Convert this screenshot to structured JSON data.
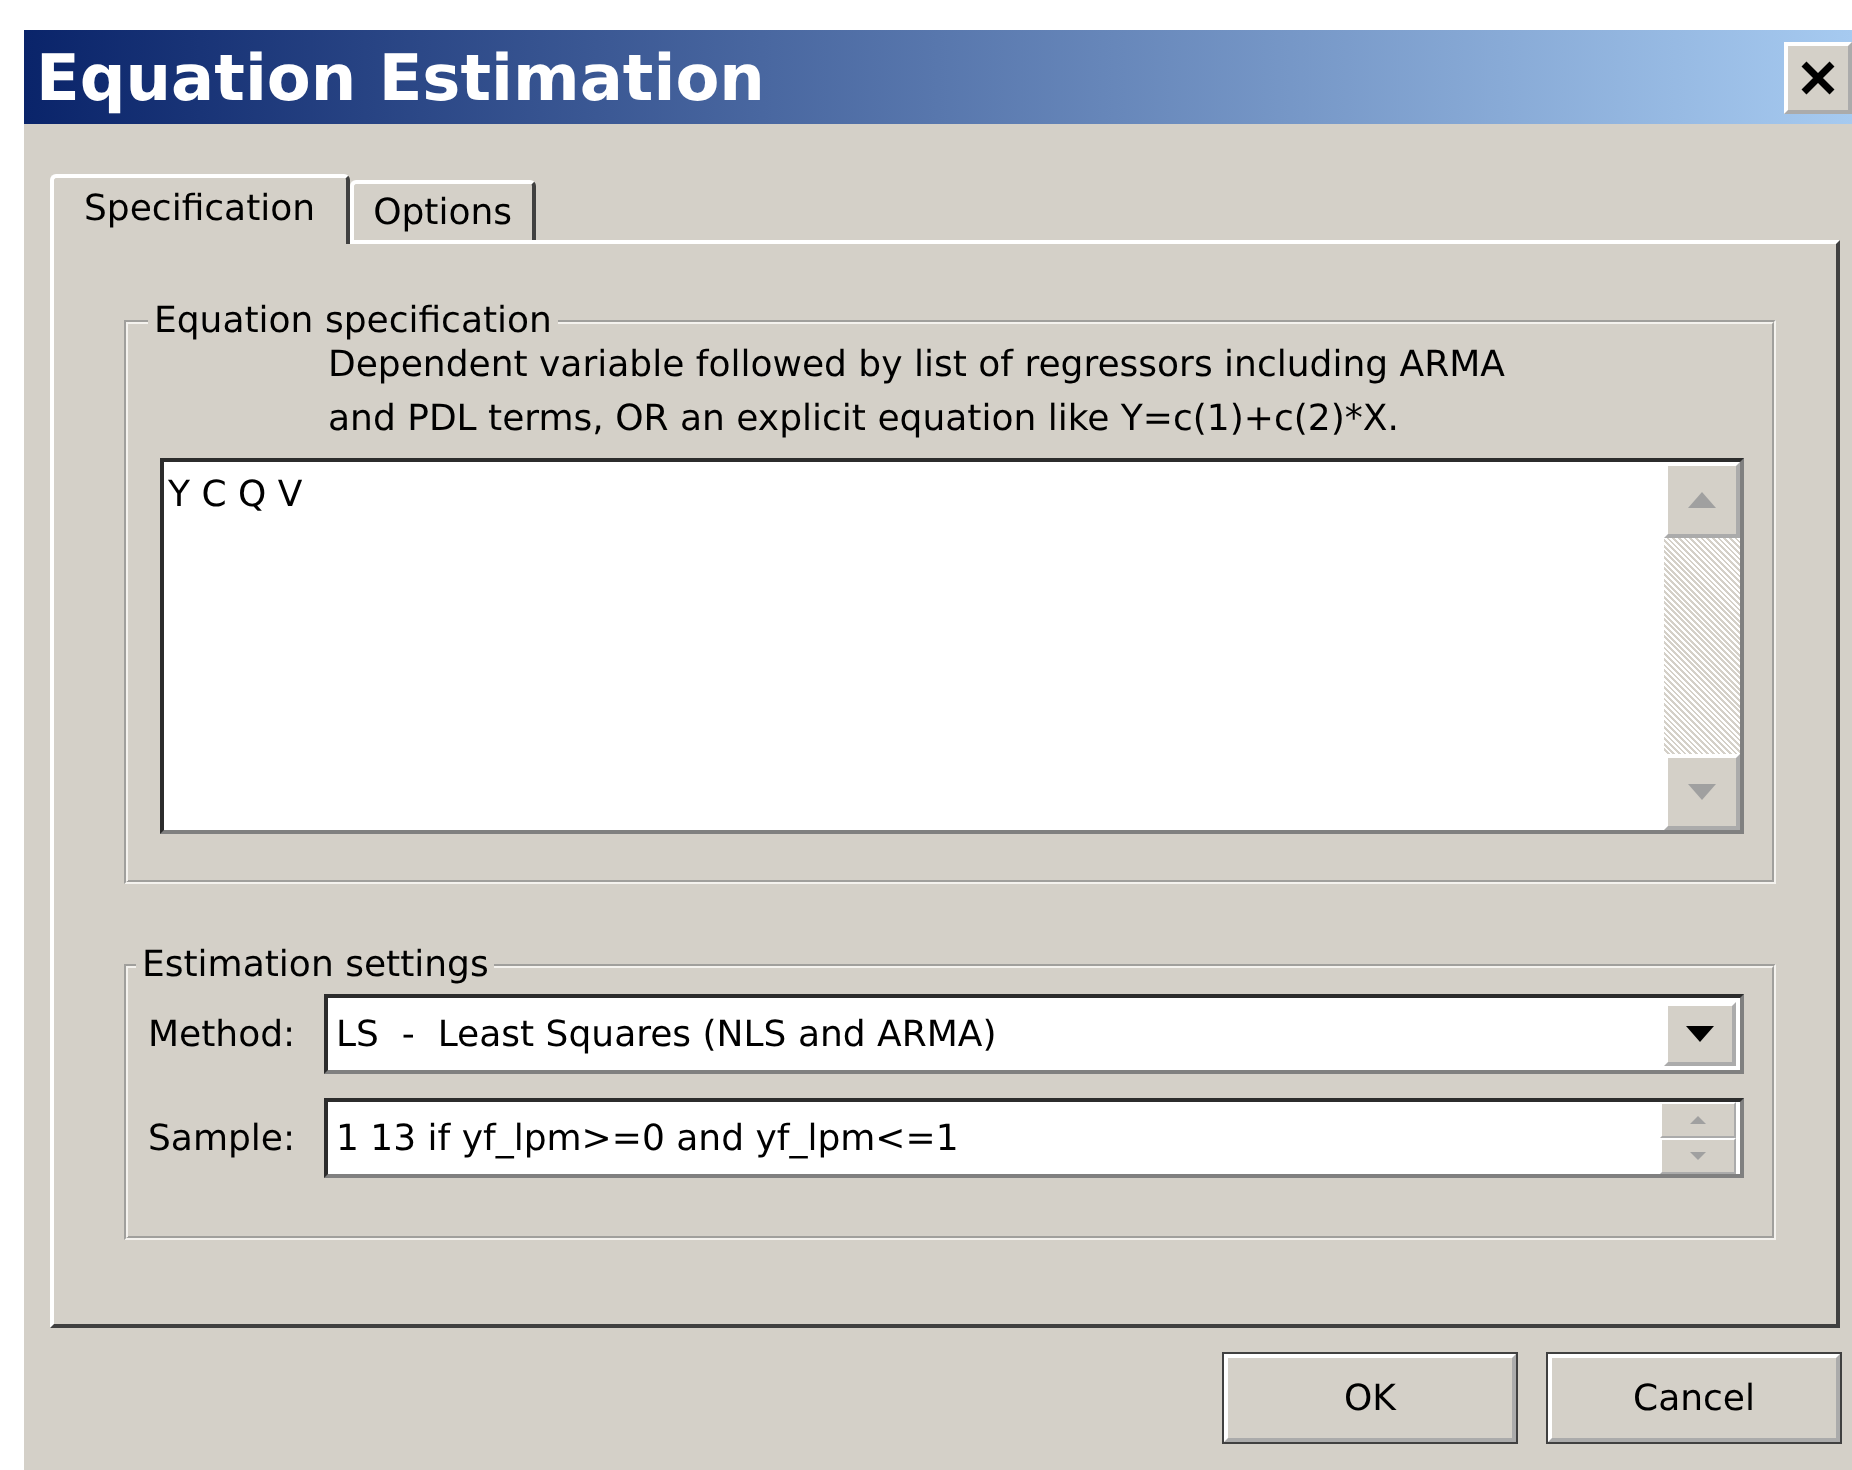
{
  "window": {
    "title": "Equation Estimation"
  },
  "tabs": [
    {
      "label": "Specification",
      "selected": true
    },
    {
      "label": "Options",
      "selected": false
    }
  ],
  "equation_specification": {
    "legend": "Equation specification",
    "hint_lines": [
      "Dependent variable followed by list of regressors including ARMA",
      "and PDL terms, OR an explicit equation like Y=c(1)+c(2)*X."
    ],
    "value": "Y C Q V"
  },
  "estimation_settings": {
    "legend": "Estimation settings",
    "method": {
      "label": "Method:",
      "value": "LS  -  Least Squares (NLS and ARMA)"
    },
    "sample": {
      "label": "Sample:",
      "value": "1 13 if yf_lpm>=0 and yf_lpm<=1"
    }
  },
  "buttons": [
    "OK",
    "Cancel"
  ]
}
